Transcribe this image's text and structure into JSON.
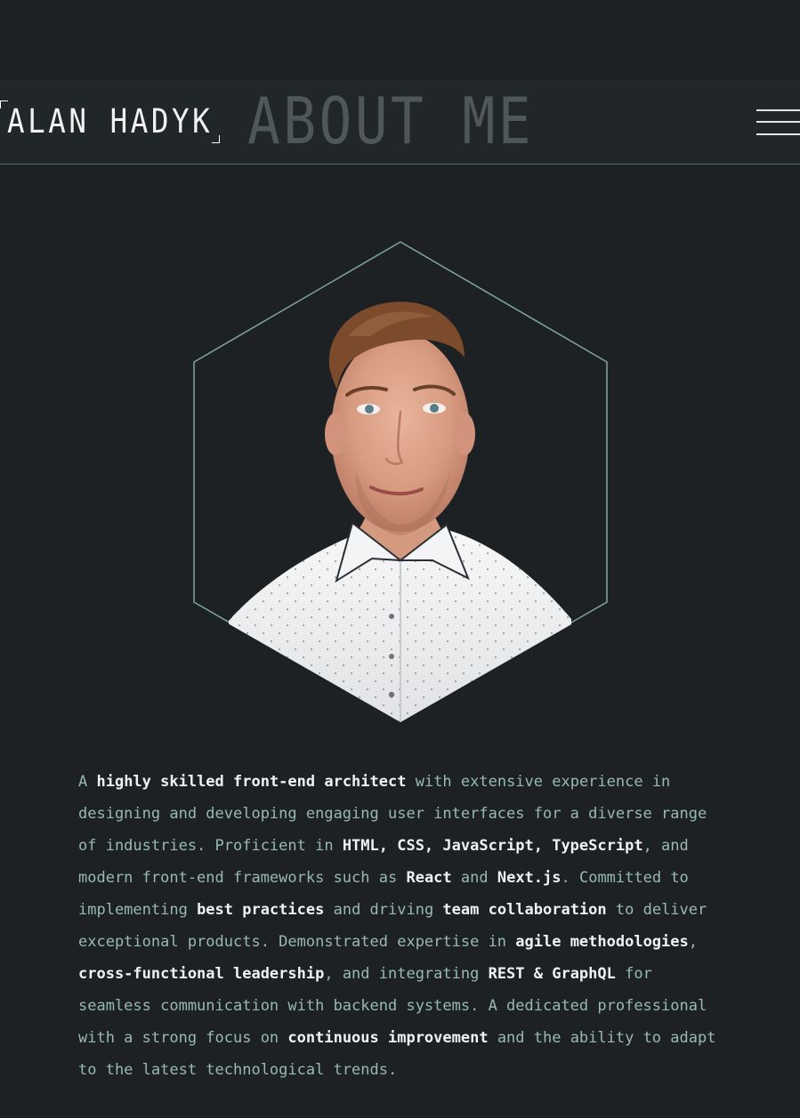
{
  "header": {
    "brand": "ALAN HADYK",
    "title": "ABOUT ME",
    "menu_icon": "hamburger-menu-icon"
  },
  "portrait": {
    "description": "hexagon-framed profile photo"
  },
  "bio": {
    "parts": [
      {
        "text": "A ",
        "bold": false
      },
      {
        "text": "highly skilled front-end architect",
        "bold": true
      },
      {
        "text": " with extensive experience in designing and developing engaging user interfaces for a diverse range of industries. Proficient in ",
        "bold": false
      },
      {
        "text": "HTML, CSS, JavaScript, TypeScript",
        "bold": true
      },
      {
        "text": ", and modern front-end frameworks such as ",
        "bold": false
      },
      {
        "text": "React",
        "bold": true
      },
      {
        "text": " and ",
        "bold": false
      },
      {
        "text": "Next.js",
        "bold": true
      },
      {
        "text": ". Committed to implementing ",
        "bold": false
      },
      {
        "text": "best practices",
        "bold": true
      },
      {
        "text": " and driving ",
        "bold": false
      },
      {
        "text": "team collaboration",
        "bold": true
      },
      {
        "text": " to deliver exceptional products. Demonstrated expertise in ",
        "bold": false
      },
      {
        "text": "agile methodologies",
        "bold": true
      },
      {
        "text": ", ",
        "bold": false
      },
      {
        "text": "cross-functional leadership",
        "bold": true
      },
      {
        "text": ", and integrating ",
        "bold": false
      },
      {
        "text": "REST & GraphQL",
        "bold": true
      },
      {
        "text": " for seamless communication with backend systems. A dedicated professional with a strong focus on ",
        "bold": false
      },
      {
        "text": "continuous improvement",
        "bold": true
      },
      {
        "text": " and the ability to adapt to the latest technological trends.",
        "bold": false
      }
    ]
  },
  "colors": {
    "background": "#1d2124",
    "header_background": "#212629",
    "accent": "#7fa7a2",
    "text": "#98b8b5",
    "strong_text": "#eef2f2",
    "title_text": "#4e5859"
  }
}
